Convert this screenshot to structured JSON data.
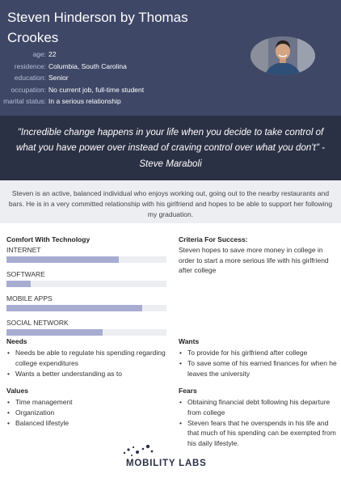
{
  "header": {
    "title": "Steven Hinderson by Thomas Crookes",
    "details": [
      {
        "label": "age:",
        "value": "22"
      },
      {
        "label": "residence:",
        "value": "Columbia, South Carolina"
      },
      {
        "label": "education:",
        "value": "Senior"
      },
      {
        "label": "occupation:",
        "value": "No current job, full-time student"
      },
      {
        "label": "marital status:",
        "value": "In a serious relationship"
      }
    ]
  },
  "quote": "\"Incredible change happens in your life when you decide to take control of what you have power over instead of craving control over what you don't\" - Steve Maraboli",
  "summary": "Steven is an active, balanced individual who enjoys working out, going out to the nearby restaurants and bars. He is in a very committed relationship with his girlfriend and hopes to be able to support her following my graduation.",
  "comfort": {
    "heading": "Comfort With Technology",
    "items": [
      {
        "label": "INTERNET",
        "level": 0.7
      },
      {
        "label": "SOFTWARE",
        "level": 0.15
      },
      {
        "label": "MOBILE APPS",
        "level": 0.85
      },
      {
        "label": "SOCIAL NETWORK",
        "level": 0.6
      }
    ]
  },
  "criteria": {
    "heading": "Criteria For Success:",
    "text": "Steven hopes to save more money in college in order to start a more serious life with his girlfriend after college"
  },
  "needs": {
    "heading": "Needs",
    "items": [
      "Needs be able to regulate his spending regarding college expenditures",
      "Wants a better understanding as to"
    ]
  },
  "wants": {
    "heading": "Wants",
    "items": [
      "To provide for his girlfriend after college",
      "To save some of his earned finances for when he leaves the university"
    ]
  },
  "values": {
    "heading": "Values",
    "items": [
      "Time management",
      "Organization",
      "Balanced lifestyle"
    ]
  },
  "fears": {
    "heading": "Fears",
    "items": [
      "Obtaining financial debt following his departure from college",
      "Steven fears that he overspends in his life and that much of his spending can be exempted from his daily lifestyle."
    ]
  },
  "logo": {
    "text": "MOBILITY LABS",
    "color": "#2b3144"
  }
}
